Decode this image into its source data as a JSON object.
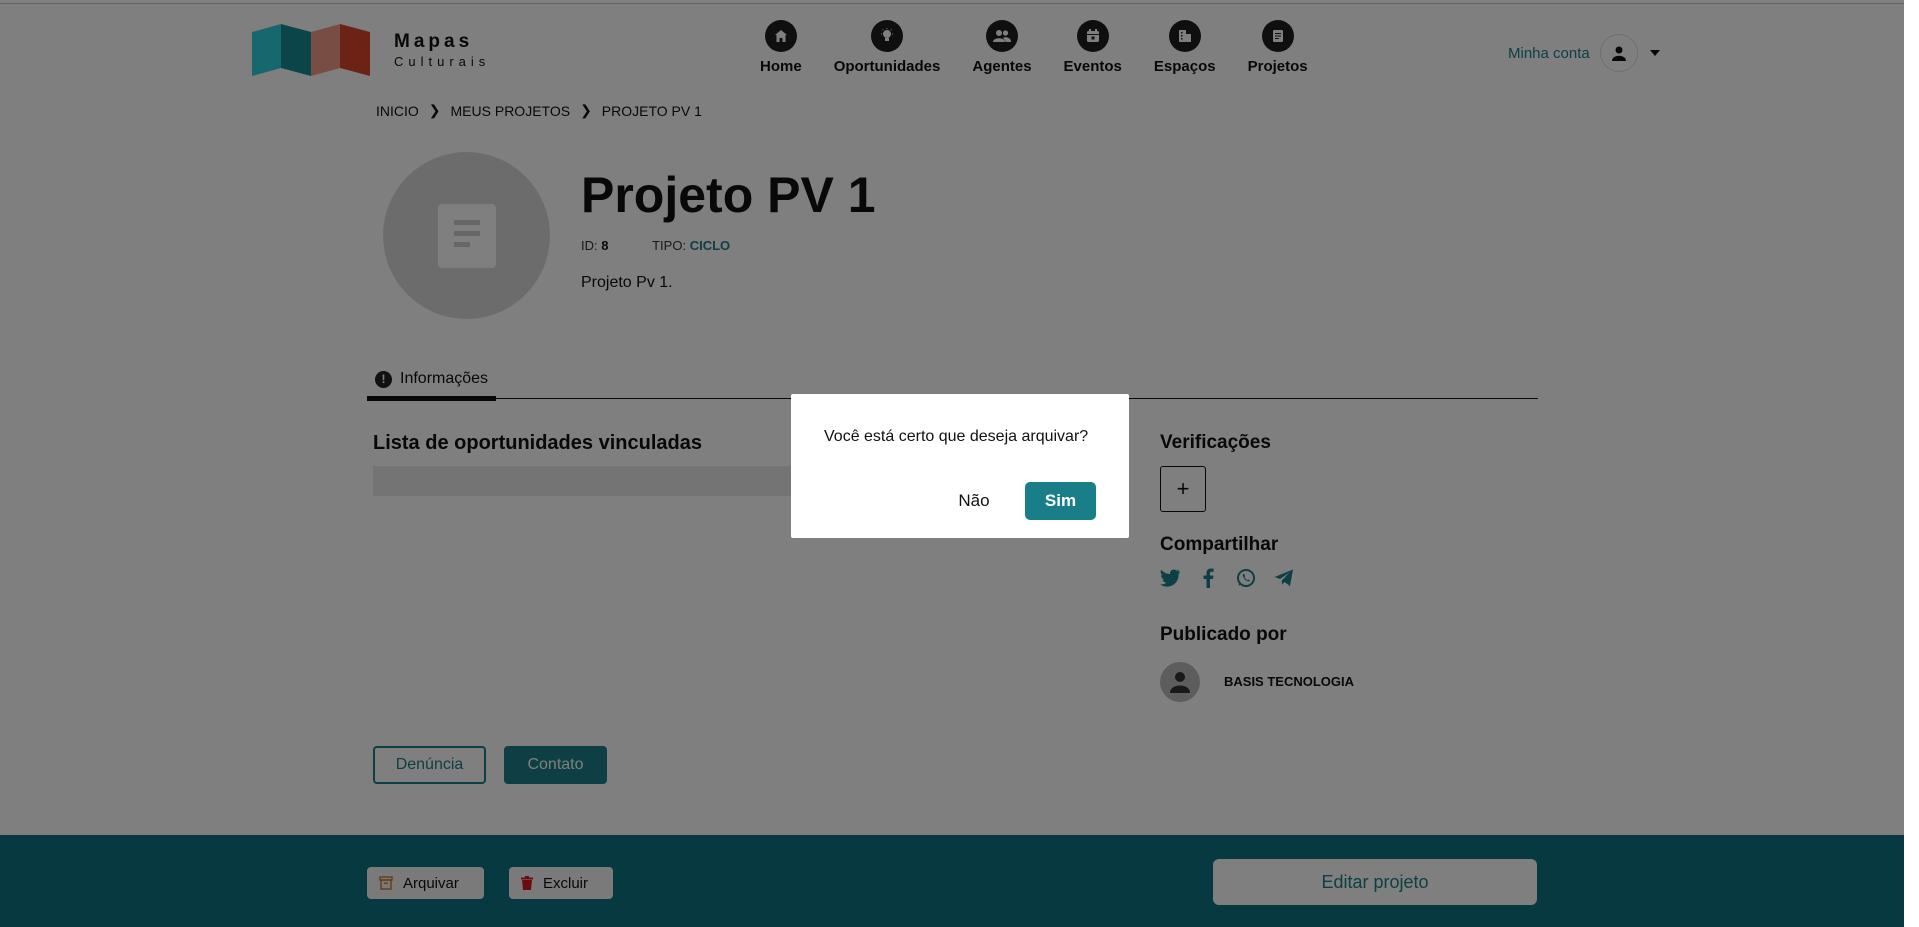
{
  "header": {
    "logo_line1": "Mapas",
    "logo_line2": "Culturais",
    "nav": [
      {
        "label": "Home",
        "icon": "home-icon"
      },
      {
        "label": "Oportunidades",
        "icon": "lightbulb-icon"
      },
      {
        "label": "Agentes",
        "icon": "people-icon"
      },
      {
        "label": "Eventos",
        "icon": "calendar-icon"
      },
      {
        "label": "Espaços",
        "icon": "building-icon"
      },
      {
        "label": "Projetos",
        "icon": "document-icon"
      }
    ],
    "account_label": "Minha conta"
  },
  "breadcrumb": [
    "INICIO",
    "MEUS PROJETOS",
    "PROJETO PV 1"
  ],
  "project": {
    "title": "Projeto PV 1",
    "id_label": "ID:",
    "id_value": "8",
    "type_label": "TIPO:",
    "type_value": "CICLO",
    "description": "Projeto Pv 1."
  },
  "tabs": [
    {
      "label": "Informações"
    }
  ],
  "sections": {
    "opportunities_title": "Lista de oportunidades vinculadas",
    "verifications_title": "Verificações",
    "share_title": "Compartilhar",
    "published_title": "Publicado por",
    "publisher_name": "BASIS TECNOLOGIA"
  },
  "buttons": {
    "report": "Denúncia",
    "contact": "Contato",
    "archive": "Arquivar",
    "delete": "Excluir",
    "edit": "Editar projeto"
  },
  "modal": {
    "message": "Você está certo que deseja arquivar?",
    "no": "Não",
    "yes": "Sim"
  },
  "colors": {
    "accent": "#1a7e88",
    "footer": "#0e7580",
    "overlay": "rgba(0,0,0,0.5)"
  }
}
